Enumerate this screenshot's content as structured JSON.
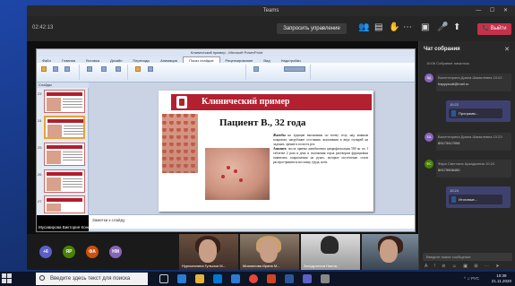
{
  "window": {
    "title": "Teams"
  },
  "meeting": {
    "time": "02:42:13",
    "control_label": "Запросить управление",
    "leave_label": "Выйти"
  },
  "ppt": {
    "title": "Клинический пример - Microsoft PowerPoint",
    "tabs": [
      "Файл",
      "Главная",
      "Вставка",
      "Дизайн",
      "Переходы",
      "Анимация",
      "Показ слайдов",
      "Рецензирование",
      "Вид",
      "Надстройки"
    ],
    "active_tab": "Показ слайдов",
    "slides_tab": "Слайды",
    "notes_placeholder": "Заметки к слайду",
    "presenter": "Мусавирова Виктория Константиновна"
  },
  "slide": {
    "header": "Клинический пример",
    "patient": "Пациент В., 32 года",
    "complaints_label": "Жалобы",
    "complaints": " на зудящие высыпания по всему телу, над кожным покровом, нагрубание состояния, высыпания в виде пузырей на ладонях, зрение и полость рта.",
    "anamnesis_label": "Анамнез:",
    "anamnesis": " после приема антибиотика ципрофлоксацин 500 мг по 1 таблетке 2 раза в день и положения горла раствором фурацилина появились покраснения на руках, которые постепенно стали распространяться на спину, грудь, ноги."
  },
  "participants": [
    {
      "initials": "+6",
      "color": "#5b5fc7"
    },
    {
      "initials": "ЯР",
      "color": "#498205"
    },
    {
      "initials": "ФА",
      "color": "#ca5010"
    },
    {
      "initials": "НМ",
      "color": "#8764b8"
    }
  ],
  "video_names": [
    "Нурсыгалина Гульсъм М...",
    "Михаилова Ирина М...",
    "Загидуллина Наиля..."
  ],
  "chat": {
    "title": "Чат собрания",
    "system": "10:06  Собрание началось",
    "messages": [
      {
        "initials": "ВД",
        "color": "#8764b8",
        "name": "Валентирина Диана Шамилевна  10:02",
        "text": "happyscat@mail.ru"
      },
      {
        "own": true,
        "time": "10:22",
        "file": "Программ..."
      },
      {
        "initials": "ЕА",
        "color": "#8764b8",
        "name": "Валентирина Диана Шамилевна  10:23",
        "text": "89173417006"
      },
      {
        "initials": "ФС",
        "color": "#498205",
        "name": "Фара Светлана Аркадьевна  10:24",
        "text": "89173906450"
      },
      {
        "own": true,
        "time": "10:24",
        "file": "Итоговые..."
      }
    ],
    "input_placeholder": "Введите новое сообщение"
  },
  "taskbar": {
    "search_placeholder": "Введите здесь текст для поиска",
    "clock_time": "10:39",
    "clock_date": "21.11.2020",
    "tray": "^ ♫ РУС"
  }
}
